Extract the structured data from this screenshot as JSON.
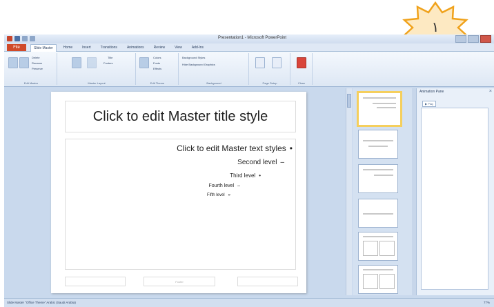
{
  "callout": {
    "number": "١"
  },
  "window": {
    "title": "Presentation1 - Microsoft PowerPoint"
  },
  "tabs": {
    "file": "File",
    "items": [
      "Slide Master",
      "Home",
      "Insert",
      "Transitions",
      "Animations",
      "Review",
      "View",
      "Add-Ins"
    ]
  },
  "ribbon": {
    "groups": [
      {
        "label": "Edit Master",
        "buttons": [
          "Insert Slide Master",
          "Insert Layout"
        ],
        "small": [
          "Delete",
          "Rename",
          "Preserve"
        ]
      },
      {
        "label": "Master Layout",
        "buttons": [
          "Master Layout",
          "Insert Placeholder"
        ],
        "small": [
          "Title",
          "Footers"
        ]
      },
      {
        "label": "Edit Theme",
        "buttons": [
          "Themes"
        ],
        "small": [
          "Colors",
          "Fonts",
          "Effects"
        ]
      },
      {
        "label": "Background",
        "buttons": [],
        "small": [
          "Background Styles",
          "Hide Background Graphics"
        ]
      },
      {
        "label": "Page Setup",
        "buttons": [
          "Page Setup",
          "Slide Orientation"
        ],
        "small": []
      },
      {
        "label": "Close",
        "buttons": [
          "Close Master View"
        ],
        "small": []
      }
    ]
  },
  "slide": {
    "title": "Click to edit Master title style",
    "levels": [
      {
        "text": "Click to edit Master text styles",
        "bullet": "•"
      },
      {
        "text": "Second level",
        "bullet": "–"
      },
      {
        "text": "Third level",
        "bullet": "•"
      },
      {
        "text": "Fourth level",
        "bullet": "–"
      },
      {
        "text": "Fifth level",
        "bullet": "»"
      }
    ],
    "footer_center": "Footer"
  },
  "nav_pane": {
    "title": "Animation Pane",
    "close": "×",
    "play": "▶ Play"
  },
  "statusbar": {
    "left": "Slide Master   \"Office Theme\"   Arabic (Saudi Arabia)",
    "right": "77%"
  },
  "colors": {
    "file_tab": "#d04a2a",
    "selected_thumb": "#f5cf5d",
    "callout_fill": "#fde9c2",
    "callout_stroke": "#f0a21b"
  }
}
